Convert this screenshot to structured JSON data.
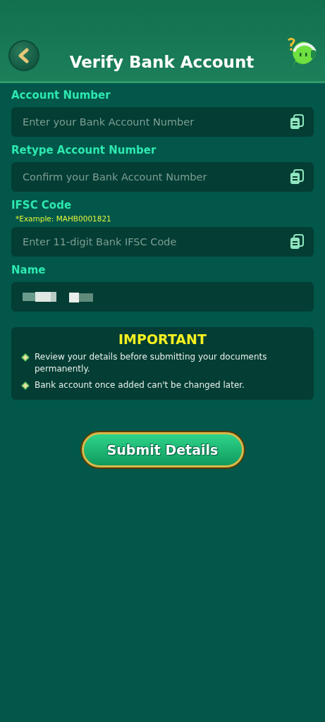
{
  "header": {
    "title": "Verify Bank Account"
  },
  "fields": [
    {
      "label": "Account Number",
      "placeholder": "Enter your Bank Account Number",
      "paste_icon": true
    },
    {
      "label": "Retype Account Number",
      "placeholder": "Confirm your Bank Account Number",
      "paste_icon": true
    },
    {
      "label": "IFSC Code",
      "hint": "*Example: MAHB0001821",
      "placeholder": "Enter 11-digit Bank IFSC Code",
      "paste_icon": true
    },
    {
      "label": "Name",
      "redacted": true,
      "paste_icon": false
    }
  ],
  "notice": {
    "title": "IMPORTANT",
    "items": [
      "Review your details before submitting your documents permanently.",
      "Bank account once added can't be changed later."
    ]
  },
  "submit_button": "Submit Details"
}
